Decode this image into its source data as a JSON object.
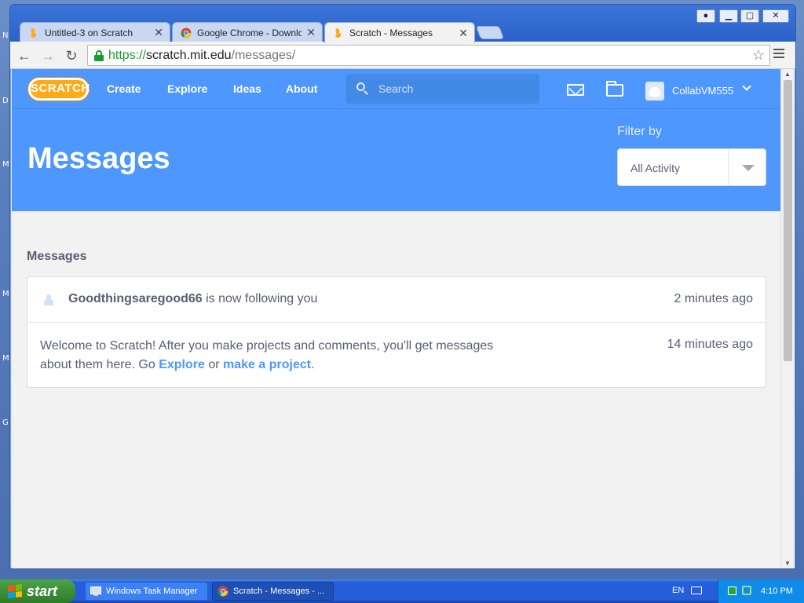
{
  "desktop": {
    "edge_letters": [
      "N",
      "D",
      "M",
      "M",
      "M",
      "G"
    ]
  },
  "browser": {
    "tabs": [
      {
        "title": "Untitled-3 on Scratch",
        "icon": "scratch-favicon",
        "active": false
      },
      {
        "title": "Google Chrome - Download t",
        "icon": "chrome-favicon",
        "active": false
      },
      {
        "title": "Scratch - Messages",
        "icon": "scratch-favicon",
        "active": true
      }
    ],
    "url": {
      "scheme": "https://",
      "host": "scratch.mit.edu",
      "path": "/messages/"
    }
  },
  "scratch": {
    "logo": "SCRATCH",
    "nav": [
      "Create",
      "Explore",
      "Ideas",
      "About"
    ],
    "search_placeholder": "Search",
    "username": "CollabVM555",
    "banner_title": "Messages",
    "filter_label": "Filter by",
    "filter_value": "All Activity",
    "section_title": "Messages",
    "messages": [
      {
        "user": "Goodthingsaregood66",
        "text": " is now following you",
        "time": "2 minutes ago"
      },
      {
        "text_a": "Welcome to Scratch! After you make projects and comments, you'll get messages about them here. Go ",
        "link_1": "Explore",
        "text_b": " or ",
        "link_2": "make a project",
        "text_c": ".",
        "time": "14 minutes ago"
      }
    ]
  },
  "taskbar": {
    "start_label": "start",
    "items": [
      {
        "label": "Windows Task Manager",
        "active": false
      },
      {
        "label": "Scratch - Messages - ...",
        "active": true
      }
    ],
    "language": "EN",
    "clock": "4:10 PM"
  },
  "colors": {
    "scratch_blue": "#4d97ff",
    "scratch_orange": "#ffab19",
    "text_gray": "#575e75",
    "secure_green": "#1a9c30"
  }
}
